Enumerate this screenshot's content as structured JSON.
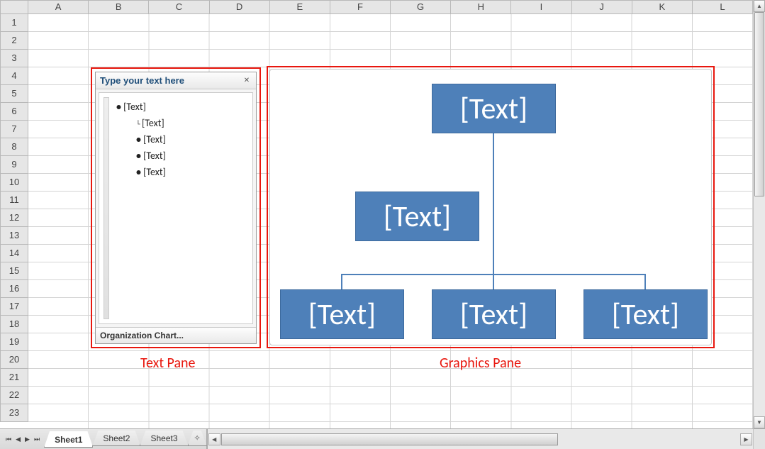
{
  "columns": [
    "A",
    "B",
    "C",
    "D",
    "E",
    "F",
    "G",
    "H",
    "I",
    "J",
    "K",
    "L"
  ],
  "rows": [
    "1",
    "2",
    "3",
    "4",
    "5",
    "6",
    "7",
    "8",
    "9",
    "10",
    "11",
    "12",
    "13",
    "14",
    "15",
    "16",
    "17",
    "18",
    "19",
    "20",
    "21",
    "22",
    "23"
  ],
  "text_pane": {
    "title": "Type your text here",
    "items": [
      {
        "level": "level1",
        "text": "[Text]"
      },
      {
        "level": "level2 assistant",
        "text": "[Text]"
      },
      {
        "level": "level2",
        "text": "[Text]"
      },
      {
        "level": "level2",
        "text": "[Text]"
      },
      {
        "level": "level2",
        "text": "[Text]"
      }
    ],
    "footer": "Organization Chart..."
  },
  "graphics": {
    "nodes": {
      "top": "[Text]",
      "assistant": "[Text]",
      "child1": "[Text]",
      "child2": "[Text]",
      "child3": "[Text]"
    }
  },
  "labels": {
    "text_pane": "Text Pane",
    "graphics_pane": "Graphics Pane"
  },
  "tabs": {
    "sheet1": "Sheet1",
    "sheet2": "Sheet2",
    "sheet3": "Sheet3"
  }
}
